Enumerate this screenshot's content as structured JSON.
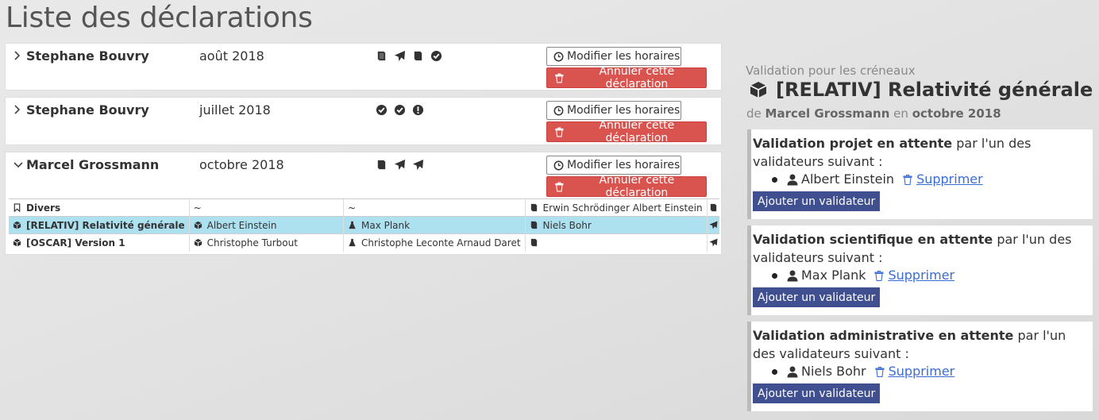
{
  "page": {
    "title": "Liste des déclarations"
  },
  "declarations": [
    {
      "person": "Stephane Bouvry",
      "period": "août 2018",
      "expanded": false,
      "status_icons": [
        "book-icon",
        "send-icon",
        "book-icon",
        "check-circle-icon"
      ],
      "modify_label": "Modifier les horaires",
      "cancel_label": "Annuler cette déclaration"
    },
    {
      "person": "Stephane Bouvry",
      "period": "juillet 2018",
      "expanded": false,
      "status_icons": [
        "check-circle-icon",
        "check-circle-icon",
        "exclamation-circle-icon"
      ],
      "modify_label": "Modifier les horaires",
      "cancel_label": "Annuler cette déclaration"
    },
    {
      "person": "Marcel Grossmann",
      "period": "octobre 2018",
      "expanded": true,
      "status_icons": [
        "book-icon",
        "send-icon",
        "send-icon"
      ],
      "modify_label": "Modifier les horaires",
      "cancel_label": "Annuler cette déclaration",
      "rows": [
        {
          "label": "Divers",
          "label_icon": "bookmark-icon",
          "c2": "~",
          "c3": "~",
          "c4": "Erwin Schrödinger Albert Einstein",
          "c4_icon": "book-icon",
          "status_icon": "book-icon",
          "highlight": false,
          "bold": true
        },
        {
          "label": "[RELATIV] Relativité générale",
          "label_icon": "cube-icon",
          "c2": "Albert Einstein",
          "c2_icon": "cube-icon",
          "c3": "Max Plank",
          "c3_icon": "flask-icon",
          "c4": "Niels Bohr",
          "c4_icon": "book-icon",
          "status_icon": "send-icon",
          "highlight": true,
          "bold": true
        },
        {
          "label": "[OSCAR] Version 1",
          "label_icon": "cube-icon",
          "c2": "Christophe Turbout",
          "c2_icon": "cube-icon",
          "c3": "Christophe Leconte Arnaud Daret",
          "c3_icon": "flask-icon",
          "c4": "",
          "c4_icon": "book-icon",
          "status_icon": "send-icon",
          "highlight": false,
          "bold": true
        }
      ]
    }
  ],
  "panel": {
    "subtitle": "Validation pour les créneaux",
    "title": "[RELATIV] Relativité générale",
    "by_prefix": "de",
    "by_person": "Marcel Grossmann",
    "by_mid": "en",
    "by_period": "octobre 2018",
    "validations": [
      {
        "strong": "Validation projet en attente",
        "rest": " par l'un des validateurs suivant :",
        "validator": "Albert Einstein",
        "delete_label": "Supprimer",
        "add_label": "Ajouter un validateur"
      },
      {
        "strong": "Validation scientifique en attente",
        "rest": " par l'un des validateurs suivant :",
        "validator": "Max Plank",
        "delete_label": "Supprimer",
        "add_label": "Ajouter un validateur"
      },
      {
        "strong": "Validation administrative en attente",
        "rest": " par l'un des validateurs suivant :",
        "validator": "Niels Bohr",
        "delete_label": "Supprimer",
        "add_label": "Ajouter un validateur"
      }
    ]
  },
  "colors": {
    "danger": "#d9534f",
    "primary": "#3f4f8f",
    "highlight_row": "#aee1ef",
    "link": "#3a6cd6"
  }
}
